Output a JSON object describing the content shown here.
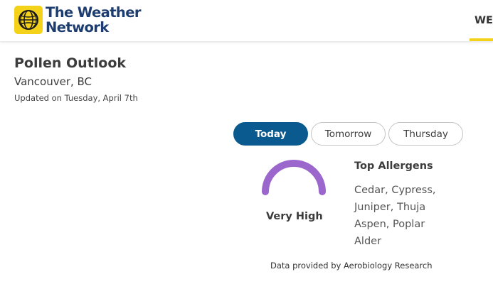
{
  "brand": {
    "line1": "The Weather",
    "line2": "Network",
    "icon": "globe-icon",
    "accent_color": "#f5d21a",
    "text_color": "#1d3c6f"
  },
  "nav": {
    "partial_item": "WE"
  },
  "pollen": {
    "title": "Pollen Outlook",
    "location": "Vancouver, BC",
    "updated": "Updated on Tuesday, April 7th",
    "tabs": [
      {
        "label": "Today",
        "active": true
      },
      {
        "label": "Tomorrow",
        "active": false
      },
      {
        "label": "Thursday",
        "active": false
      }
    ],
    "active_tab_color": "#0a5a8f",
    "level": "Very High",
    "level_color": "#9b67cc",
    "allergens_title": "Top Allergens",
    "allergens": [
      "Cedar, Cypress,",
      "Juniper, Thuja",
      "Aspen, Poplar",
      "Alder"
    ],
    "credit": "Data provided by Aerobiology Research"
  }
}
